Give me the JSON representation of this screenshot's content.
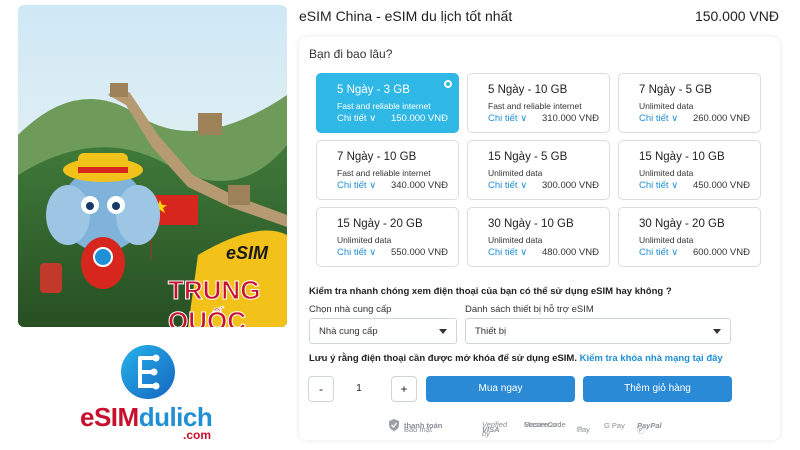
{
  "product": {
    "title": "eSIM China - eSIM du lịch tốt nhất",
    "price": "150.000 VNĐ",
    "image_badge": "eSIM",
    "image_country": "TRUNG QUỐC"
  },
  "brand": {
    "logo_prefix": "eSIM",
    "logo_suffix": "dulich",
    "logo_domain": ".com"
  },
  "plans": {
    "question": "Bạn đi bao lâu?",
    "detail_label": "Chi tiết",
    "items": [
      {
        "name": "5 Ngày - 3 GB",
        "desc": "Fast and reliable internet",
        "price": "150.000 VNĐ",
        "selected": true
      },
      {
        "name": "5 Ngày - 10 GB",
        "desc": "Fast and reliable internet",
        "price": "310.000 VNĐ",
        "selected": false
      },
      {
        "name": "7 Ngày - 5 GB",
        "desc": "Unlimited data",
        "price": "260.000 VNĐ",
        "selected": false
      },
      {
        "name": "7 Ngày - 10 GB",
        "desc": "Fast and reliable internet",
        "price": "340.000 VNĐ",
        "selected": false
      },
      {
        "name": "15 Ngày - 5 GB",
        "desc": "Unlimited data",
        "price": "300.000 VNĐ",
        "selected": false
      },
      {
        "name": "15 Ngày - 10 GB",
        "desc": "Unlimited data",
        "price": "450.000 VNĐ",
        "selected": false
      },
      {
        "name": "15 Ngày - 20 GB",
        "desc": "Unlimited data",
        "price": "550.000 VNĐ",
        "selected": false
      },
      {
        "name": "30 Ngày - 10 GB",
        "desc": "Unlimited data",
        "price": "480.000 VNĐ",
        "selected": false
      },
      {
        "name": "30 Ngày - 20 GB",
        "desc": "Unlimited data",
        "price": "600.000 VNĐ",
        "selected": false
      }
    ]
  },
  "compat": {
    "question": "Kiểm tra nhanh chóng xem điện thoại của bạn có thể sử dụng eSIM hay không ?",
    "provider_label": "Chọn nhà cung cấp",
    "provider_value": "Nhà cung cấp",
    "device_label": "Danh sách thiết bị hỗ trợ eSIM",
    "device_value": "Thiết bị",
    "note": "Lưu ý rằng điện thoại cần được mở khóa để sử dụng eSIM.",
    "note_link": "Kiểm tra khóa nhà mạng tại đây"
  },
  "purchase": {
    "minus": "-",
    "quantity": "1",
    "plus": "+",
    "buy_now": "Mua ngay",
    "add_to_cart": "Thêm giỏ hàng"
  },
  "payment": {
    "secure_label": "Bảo mật",
    "secure_strong": "thanh toán",
    "verified_line1": "Verified by",
    "verified_line2": "VISA",
    "mastercard_line1": "Mastercard",
    "mastercard_line2": "SecureCode",
    "apple_pay": "Pay",
    "google_pay": "G Pay",
    "paypal": "PayPal"
  },
  "colors": {
    "selected_plan": "#2fb8e6",
    "primary_button": "#2a8ad6",
    "link": "#1f8fd6",
    "brand_red": "#c8102e"
  }
}
